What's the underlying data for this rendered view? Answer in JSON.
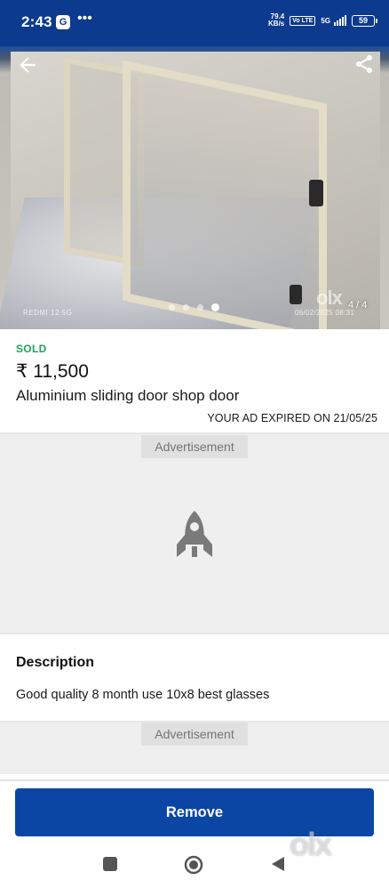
{
  "status_bar": {
    "time": "2:43",
    "google_badge": "G",
    "more": "•••",
    "net_speed_value": "79.4",
    "net_speed_unit": "KB/s",
    "volte": "Vo LTE",
    "network": "5G",
    "battery": "59"
  },
  "gallery": {
    "counter": "4 / 4",
    "watermark_left": "REDMI 12 5G",
    "watermark_right": "06/02/2025  08:31",
    "olx_watermark": "olx",
    "total_images": 4,
    "active_index": 3
  },
  "listing": {
    "status": "SOLD",
    "price": "₹ 11,500",
    "title": "Aluminium sliding door shop door",
    "expiry_notice": "YOUR AD EXPIRED ON 21/05/25"
  },
  "ads": {
    "label_1": "Advertisement",
    "label_2": "Advertisement"
  },
  "description": {
    "heading": "Description",
    "text": "Good quality 8 month use 10x8 best glasses"
  },
  "actions": {
    "remove_label": "Remove"
  },
  "corner_watermark": "olx",
  "colors": {
    "status_bar": "#0b3a8f",
    "sold_green": "#23a05a",
    "primary_button": "#0b46a5",
    "ad_background": "#efefef"
  }
}
